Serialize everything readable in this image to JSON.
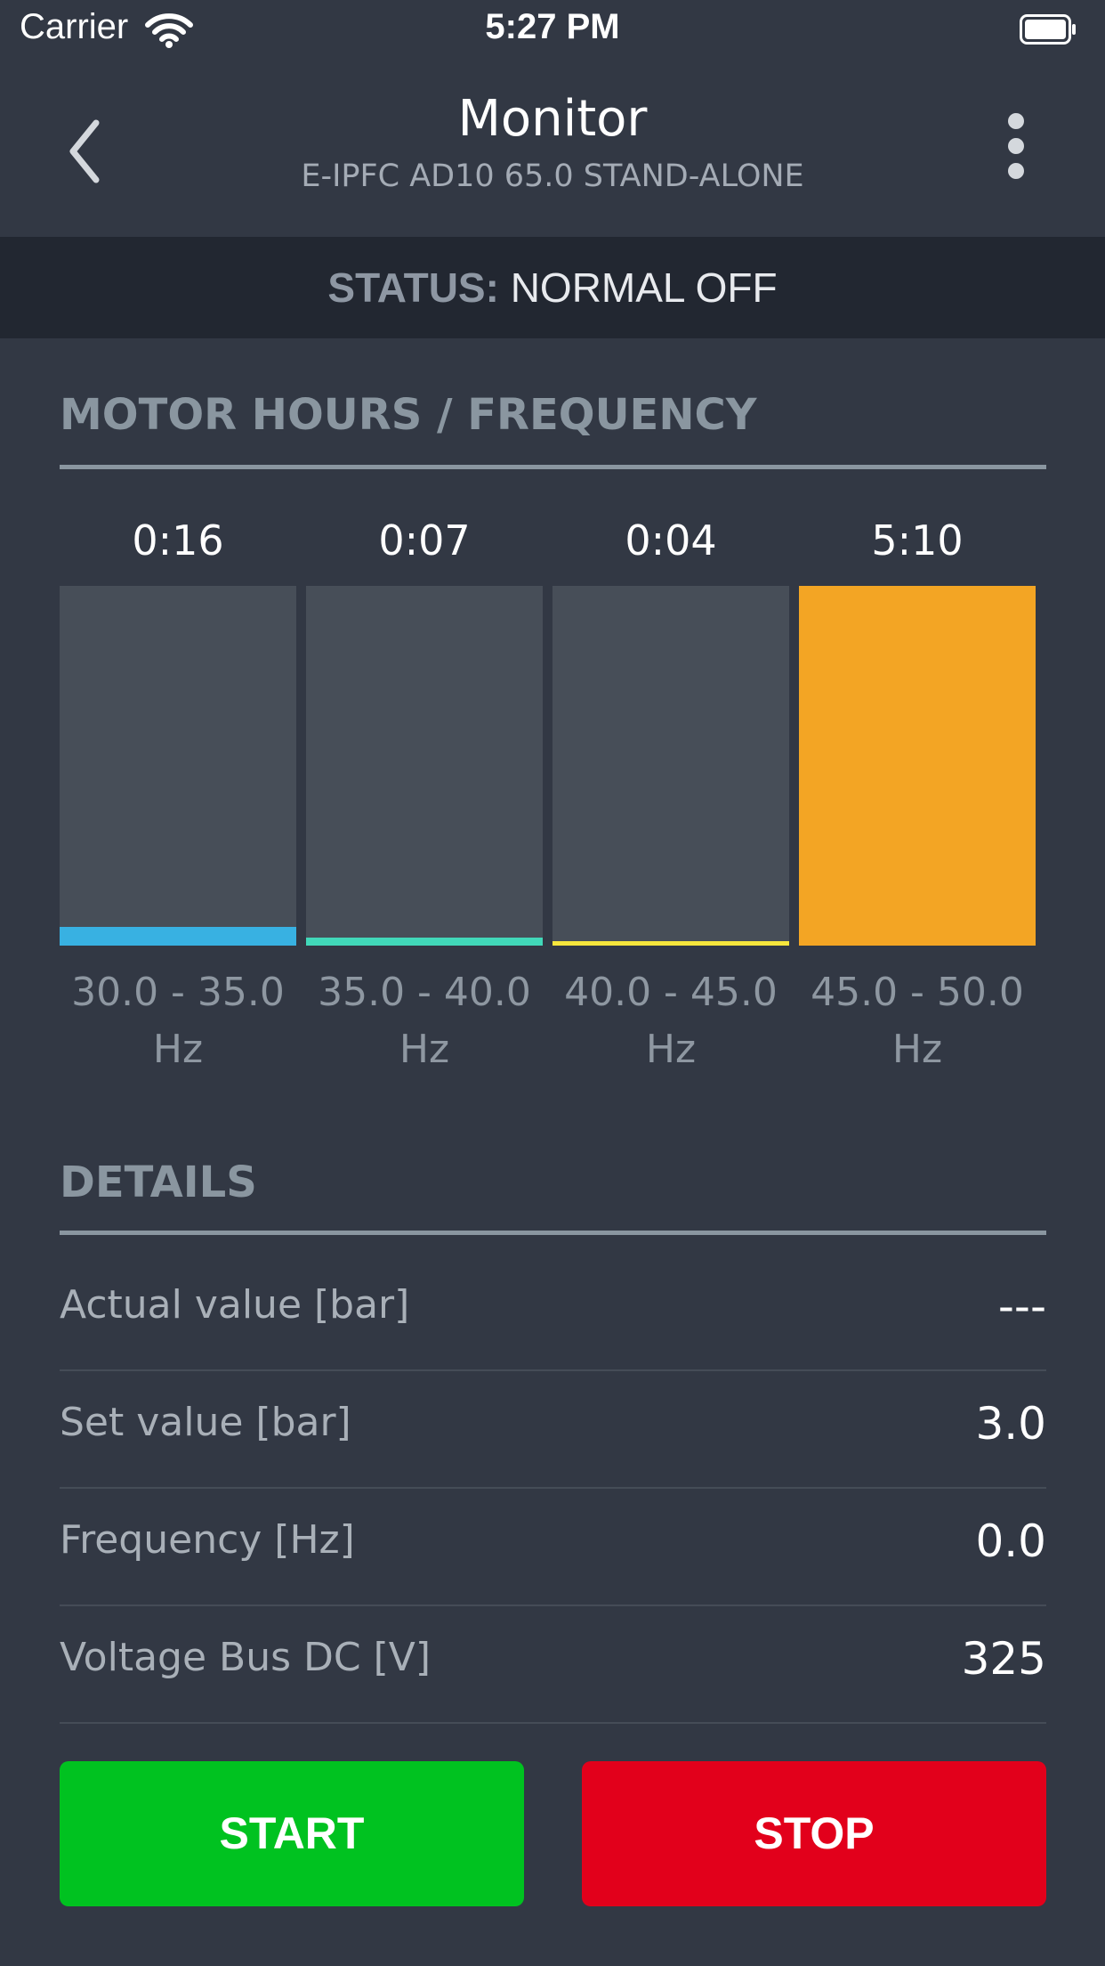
{
  "status_bar": {
    "carrier": "Carrier",
    "time": "5:27 PM",
    "icons": [
      "wifi-icon",
      "battery-icon"
    ]
  },
  "nav": {
    "title": "Monitor",
    "subtitle": "E-IPFC AD10 65.0 STAND-ALONE",
    "icons": [
      "chevron-left-icon",
      "more-vertical-icon"
    ]
  },
  "status": {
    "label": "STATUS:",
    "value": "NORMAL OFF"
  },
  "motor_hours": {
    "title": "MOTOR HOURS / FREQUENCY"
  },
  "chart_data": {
    "type": "bar",
    "title": "MOTOR HOURS / FREQUENCY",
    "categories": [
      "30.0 - 35.0 Hz",
      "35.0 - 40.0 Hz",
      "40.0 - 45.0 Hz",
      "45.0 - 50.0 Hz"
    ],
    "labels": [
      "0:16",
      "0:07",
      "0:04",
      "5:10"
    ],
    "values": [
      0.0516,
      0.0226,
      0.0129,
      1.0
    ],
    "colors": [
      "#38b1e2",
      "#41d8b9",
      "#f6e63c",
      "#f3a524"
    ],
    "range_lines": [
      [
        "30.0 - 35.0",
        "Hz"
      ],
      [
        "35.0 - 40.0",
        "Hz"
      ],
      [
        "40.0 - 45.0",
        "Hz"
      ],
      [
        "45.0 - 50.0",
        "Hz"
      ]
    ],
    "ylim": [
      0,
      1
    ],
    "grid": false
  },
  "details": {
    "title": "DETAILS",
    "rows": [
      {
        "label": "Actual value [bar]",
        "value": "---"
      },
      {
        "label": "Set value [bar]",
        "value": "3.0"
      },
      {
        "label": "Frequency [Hz]",
        "value": "0.0"
      },
      {
        "label": "Voltage Bus DC [V]",
        "value": "325"
      }
    ]
  },
  "buttons": {
    "start": "START",
    "stop": "STOP"
  },
  "colors": {
    "background": "#323844",
    "status_strip": "#222731",
    "section_header": "#8a96a0",
    "start": "#00c220",
    "stop": "#e2001b",
    "bar_background": "#474e58"
  }
}
